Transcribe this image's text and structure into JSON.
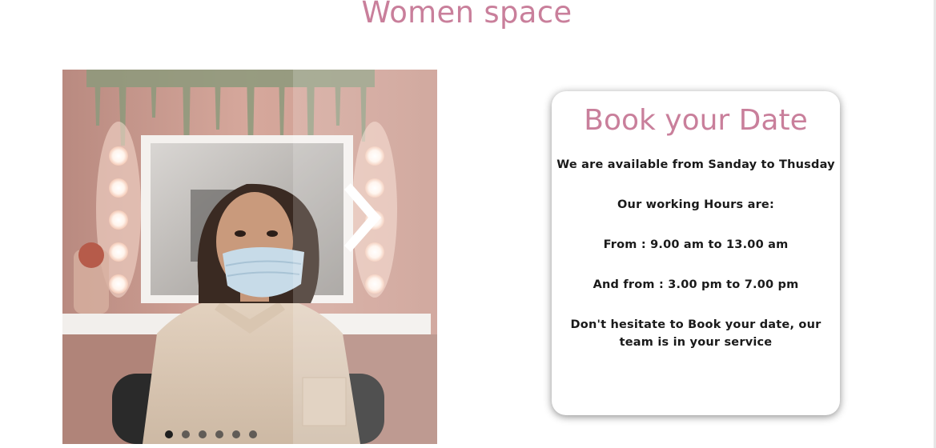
{
  "section": {
    "title": "Women space"
  },
  "carousel": {
    "image_alt": "Woman wearing a face mask in a beauty salon",
    "slide_count": 6,
    "active_slide": 1,
    "next_icon": "chevron-right-icon"
  },
  "booking": {
    "title": "Book your Date",
    "availability": "We are available from Sanday to Thusday",
    "hours_heading": "Our working Hours are:",
    "morning_hours": "From : 9.00 am to 13.00 am",
    "evening_hours": "And from : 3.00 pm to 7.00 pm",
    "closing_note": "Don't hesitate to Book your date, our team is in your service"
  },
  "colors": {
    "accent": "#c97f9b",
    "text": "#1a1a1a",
    "background": "#ffffff"
  }
}
